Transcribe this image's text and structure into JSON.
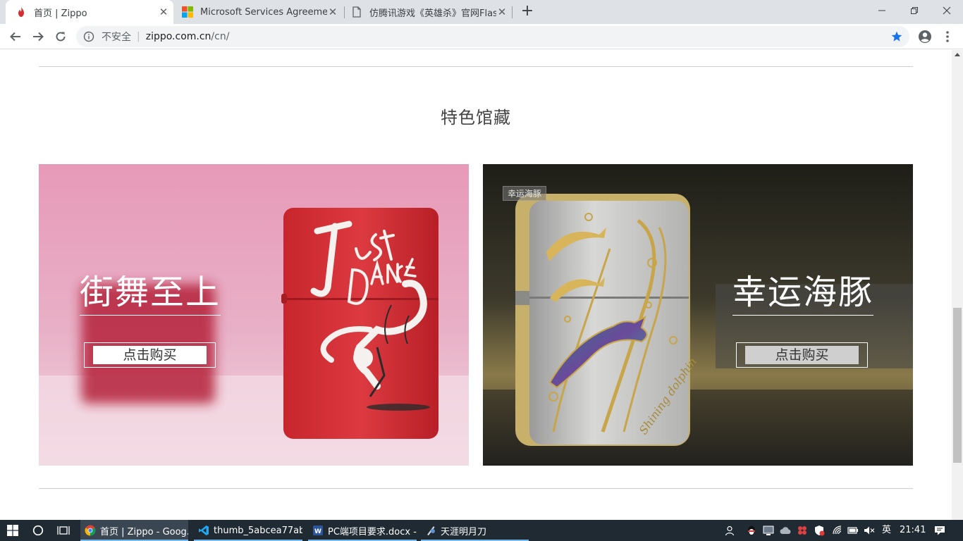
{
  "browser": {
    "tabs": [
      {
        "title": "首页 | Zippo",
        "active": true,
        "icon": "flame-icon"
      },
      {
        "title": "Microsoft Services Agreement",
        "active": false,
        "icon": "microsoft-logo-icon"
      },
      {
        "title": "仿腾讯游戏《英雄杀》官网Flash",
        "active": false,
        "icon": "document-icon"
      }
    ],
    "address": {
      "security_label": "不安全",
      "domain": "zippo.com.cn",
      "path": "/cn/"
    }
  },
  "page": {
    "section_title": "特色馆藏",
    "cards": [
      {
        "heading": "街舞至上",
        "button_label": "点击购买"
      },
      {
        "heading": "幸运海豚",
        "button_label": "点击购买",
        "tag": "幸运海豚"
      }
    ]
  },
  "taskbar": {
    "apps": [
      {
        "label": "首页 | Zippo - Goog...",
        "icon": "chrome-icon"
      },
      {
        "label": "thumb_5abcea77ab...",
        "icon": "vscode-icon"
      },
      {
        "label": "PC端项目要求.docx -...",
        "icon": "word-icon"
      },
      {
        "label": "天涯明月刀",
        "icon": "game-icon"
      }
    ],
    "ime": "英",
    "clock": "21:41"
  },
  "colors": {
    "accent_blue": "#1a73e8",
    "tab_strip": "#dee1e6",
    "taskbar": "#1f2a33",
    "card_left_bg": "#e7a8c0",
    "lighter_red": "#d8343a",
    "card_right_bg": "#2a2a22",
    "gold": "#c9a54a"
  }
}
